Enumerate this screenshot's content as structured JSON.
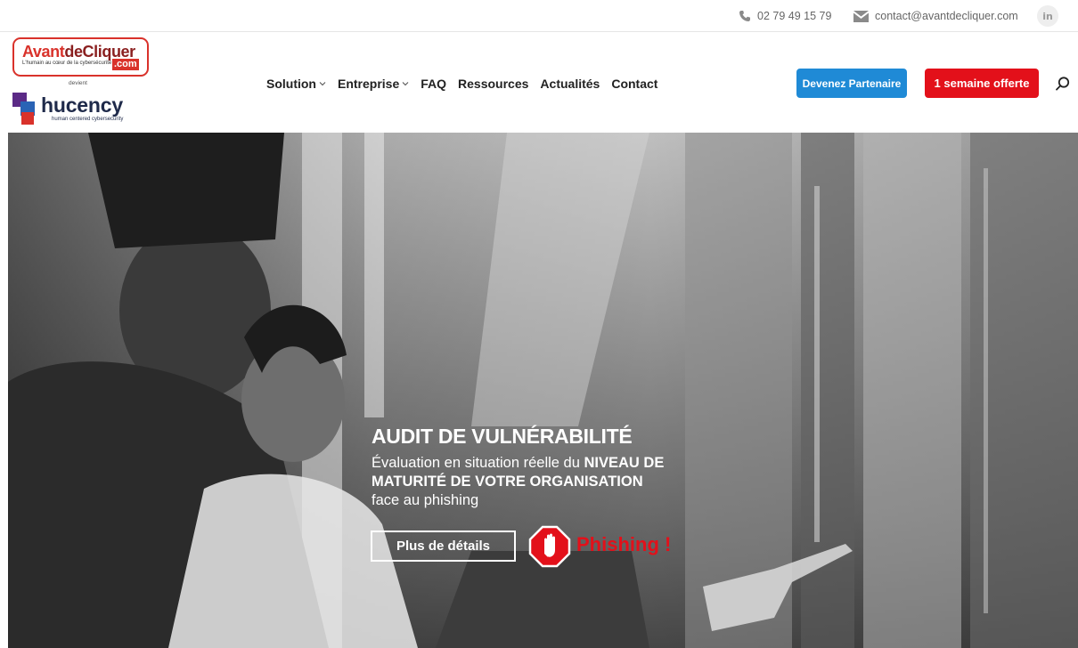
{
  "topbar": {
    "phone": "02 79 49 15 79",
    "email": "contact@avantdecliquer.com",
    "linkedin_label": "in"
  },
  "logo": {
    "brand_part1": "Avant",
    "brand_part2": "deCliquer",
    "dotcom": ".com",
    "tagline": "L'humain au cœur de la cybersécurité",
    "devient": "devient",
    "new_brand": "hucency",
    "new_brand_sub": "human centered cybersecurity"
  },
  "nav": {
    "items": [
      {
        "label": "Solution",
        "dropdown": true
      },
      {
        "label": "Entreprise",
        "dropdown": true
      },
      {
        "label": "FAQ",
        "dropdown": false
      },
      {
        "label": "Ressources",
        "dropdown": false
      },
      {
        "label": "Actualités",
        "dropdown": false
      },
      {
        "label": "Contact",
        "dropdown": false
      }
    ],
    "partner_button": "Devenez Partenaire",
    "offer_button": "1 semaine offerte"
  },
  "hero": {
    "title": "AUDIT DE VULNÉRABILITÉ",
    "text_1": "Évaluation en situation réelle du ",
    "text_bold": "NIVEAU DE MATURITÉ DE VOTRE ORGANISATION",
    "text_2": "face au phishing",
    "details_button": "Plus de détails",
    "stop_label": "STOP",
    "phishing_label": "Phishing !"
  },
  "colors": {
    "partner_blue": "#1f8ad6",
    "offer_red": "#e3101a",
    "brand_red": "#d9322b"
  },
  "icons": [
    "phone-icon",
    "mail-icon",
    "linkedin-icon",
    "chevron-down-icon",
    "search-icon",
    "stop-hand-icon"
  ]
}
